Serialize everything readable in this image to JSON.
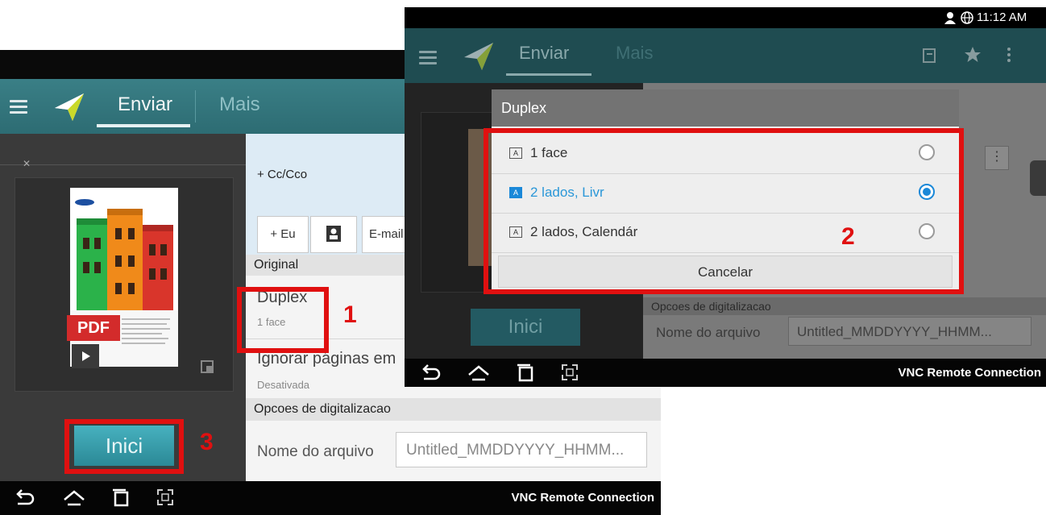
{
  "left_screen": {
    "tabs": {
      "active": "Enviar",
      "inactive": "Mais"
    },
    "cc_label": "+ Cc/Cco",
    "eu_button": "+ Eu",
    "email_button": "E-mail",
    "pdf_badge": "PDF",
    "section_original": "Original",
    "duplex": {
      "title": "Duplex",
      "value": "1 face"
    },
    "ignore": {
      "title": "Ignorar páginas em",
      "value": "Desativada"
    },
    "section_scan": "Opcoes de digitalizacao",
    "filename": {
      "label": "Nome do arquivo",
      "value": "Untitled_MMDDYYYY_HHMM..."
    },
    "start_button": "Inici",
    "nav_label": "VNC Remote Connection"
  },
  "right_screen": {
    "status_time": "11:12 AM",
    "tabs": {
      "active": "Enviar",
      "inactive": "Mais"
    },
    "dialog": {
      "title": "Duplex",
      "options": [
        {
          "label": "1 face",
          "selected": false
        },
        {
          "label": "2 lados, Livr",
          "selected": true
        },
        {
          "label": "2 lados, Calendár",
          "selected": false
        }
      ],
      "cancel": "Cancelar"
    },
    "section_scan": "Opcoes de digitalizacao",
    "filename": {
      "label": "Nome do arquivo",
      "value": "Untitled_MMDDYYYY_HHMM..."
    },
    "start_button": "Inici",
    "nav_label": "VNC Remote Connection"
  },
  "annotations": {
    "step1": "1",
    "step2": "2",
    "step3": "3"
  },
  "colors": {
    "highlight": "#e01010",
    "accent": "#2d6c73",
    "selected": "#1a88d8"
  }
}
